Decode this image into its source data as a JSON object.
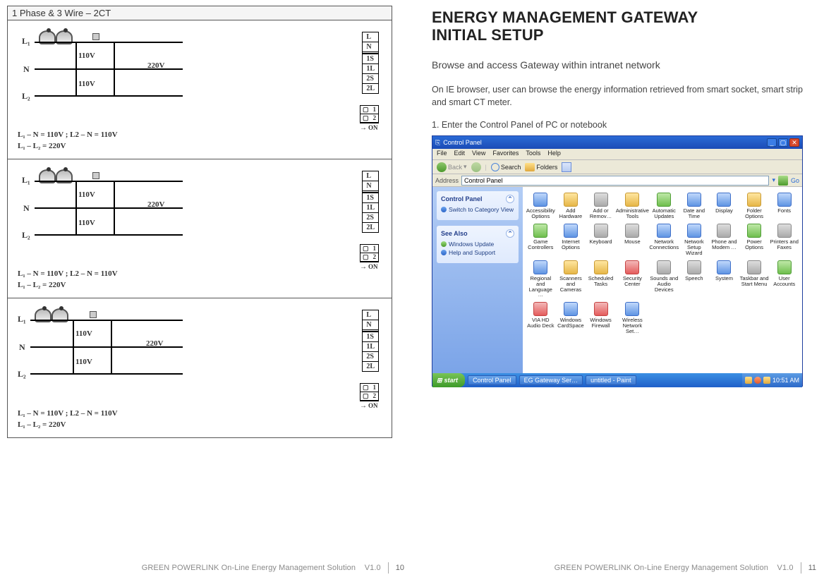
{
  "left": {
    "diagram_title": "1 Phase & 3 Wire – 2CT",
    "panels": [
      {
        "l1": "L₁",
        "n": "N",
        "l2": "L₂",
        "v_top": "110V",
        "v_mid": "220V",
        "v_bot": "110V",
        "term": [
          "L",
          "N",
          "1S",
          "1L",
          "2S",
          "2L"
        ],
        "dip": {
          "rows": [
            "1",
            "2"
          ],
          "on": "ON"
        },
        "cap1": "L₁ – N = 110V ; L2 – N = 110V",
        "cap2": "L₁ – L₂ = 220V"
      },
      {
        "l1": "L₁",
        "n": "N",
        "l2": "L₂",
        "v_top": "110V",
        "v_mid": "220V",
        "v_bot": "110V",
        "term": [
          "L",
          "N",
          "1S",
          "1L",
          "2S",
          "2L"
        ],
        "dip": {
          "rows": [
            "1",
            "2"
          ],
          "on": "ON"
        },
        "cap1": "L₁ – N = 110V ; L2 – N = 110V",
        "cap2": "L₁ – L₂ = 220V"
      },
      {
        "l1": "L₁",
        "n": "N",
        "l2": "L₂",
        "v_top": "110V",
        "v_mid": "220V",
        "v_bot": "110V",
        "term": [
          "L",
          "N",
          "1S",
          "1L",
          "2S",
          "2L"
        ],
        "dip": {
          "rows": [
            "1",
            "2"
          ],
          "on": "ON"
        },
        "cap1": "L₁ – N = 110V ; L2 – N = 110V",
        "cap2": "L₁ – L₂ = 220V"
      }
    ]
  },
  "right": {
    "heading_l1": "ENERGY MANAGEMENT GATEWAY",
    "heading_l2": "INITIAL SETUP",
    "subhead": "Browse and access Gateway within intranet network",
    "intro": "On IE browser, user can browse the energy information retrieved from smart socket, smart strip and smart CT meter.",
    "step1": "1. Enter the Control Panel of PC or notebook",
    "cp": {
      "title": "Control Panel",
      "menu": [
        "File",
        "Edit",
        "View",
        "Favorites",
        "Tools",
        "Help"
      ],
      "toolbar": {
        "back": "Back",
        "search": "Search",
        "folders": "Folders"
      },
      "address_label": "Address",
      "address_value": "Control Panel",
      "go": "Go",
      "pane1": {
        "title": "Control Panel",
        "link": "Switch to Category View"
      },
      "pane2": {
        "title": "See Also",
        "links": [
          "Windows Update",
          "Help and Support"
        ]
      },
      "items": [
        "Accessibility Options",
        "Add Hardware",
        "Add or Remov…",
        "Administrative Tools",
        "Automatic Updates",
        "Date and Time",
        "Display",
        "Folder Options",
        "Fonts",
        "Game Controllers",
        "Internet Options",
        "Keyboard",
        "Mouse",
        "Network Connections",
        "Network Setup Wizard",
        "Phone and Modem …",
        "Power Options",
        "Printers and Faxes",
        "Regional and Language …",
        "Scanners and Cameras",
        "Scheduled Tasks",
        "Security Center",
        "Sounds and Audio Devices",
        "Speech",
        "System",
        "Taskbar and Start Menu",
        "User Accounts",
        "VIA HD Audio Deck",
        "Windows CardSpace",
        "Windows Firewall",
        "Wireless Network Set…"
      ],
      "taskbar": {
        "start": "start",
        "tasks": [
          "Control Panel",
          "EG Gateway Ser…",
          "untitled - Paint"
        ],
        "time": "10:51 AM"
      }
    }
  },
  "footer": {
    "product": "GREEN POWERLINK On-Line Energy Management Solution",
    "version": "V1.0",
    "page_left": "10",
    "page_right": "11"
  }
}
